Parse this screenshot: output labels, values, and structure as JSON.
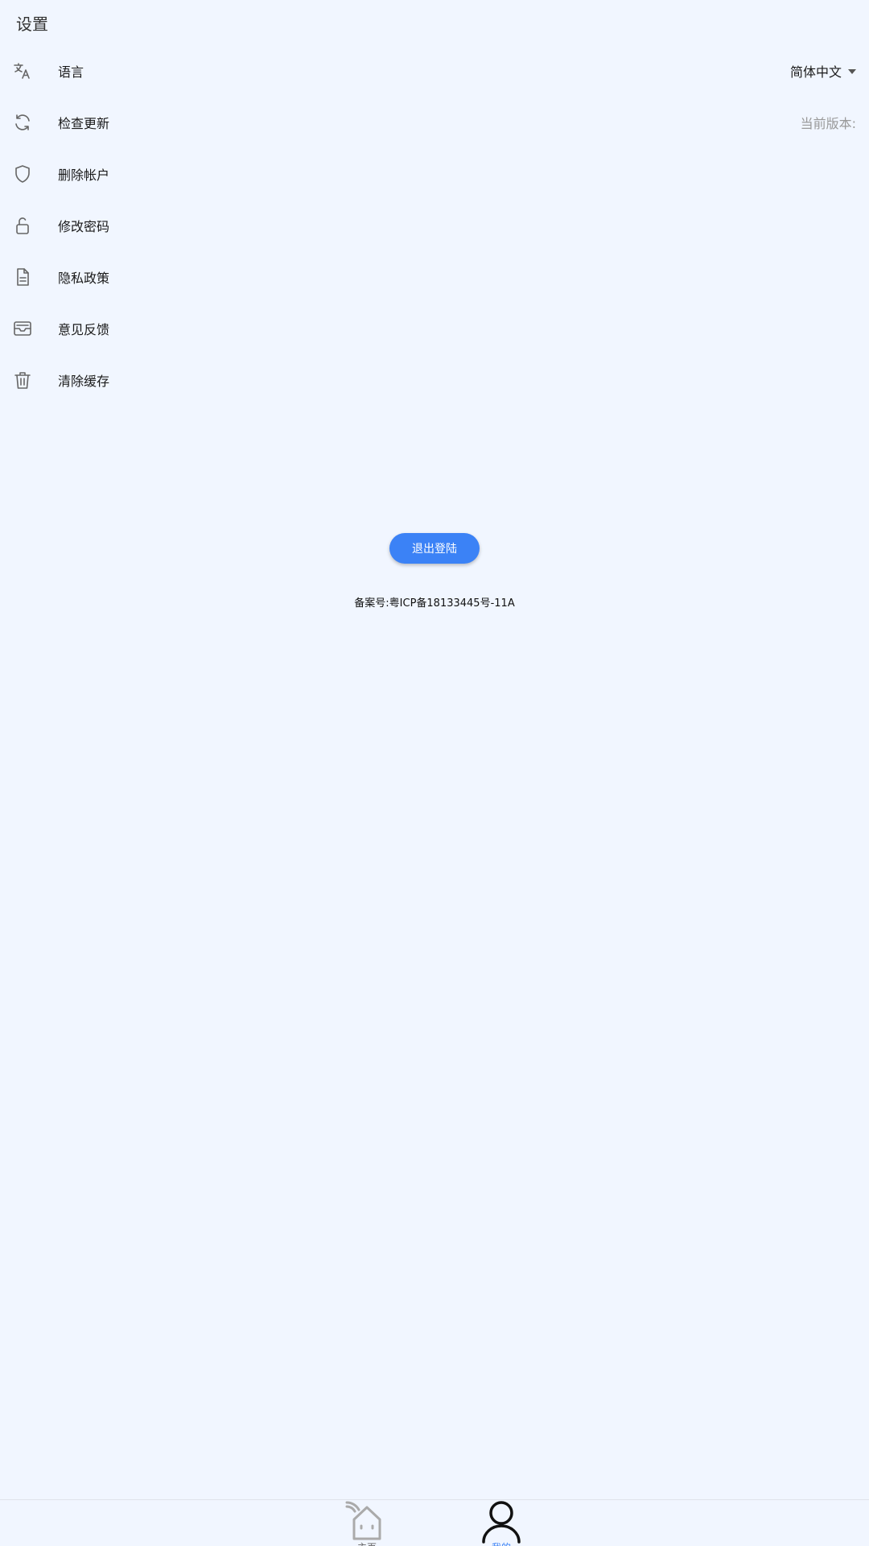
{
  "header": {
    "title": "设置"
  },
  "settings": {
    "items": [
      {
        "icon": "translate-icon",
        "label": "语言"
      },
      {
        "icon": "refresh-icon",
        "label": "检查更新"
      },
      {
        "icon": "shield-icon",
        "label": "删除帐户"
      },
      {
        "icon": "unlock-icon",
        "label": "修改密码"
      },
      {
        "icon": "document-icon",
        "label": "隐私政策"
      },
      {
        "icon": "inbox-icon",
        "label": "意见反馈"
      },
      {
        "icon": "trash-icon",
        "label": "清除缓存"
      }
    ],
    "language_value": "简体中文",
    "version_label": "当前版本:"
  },
  "logout": {
    "label": "退出登陆"
  },
  "footer": {
    "icp": "备案号:粤ICP备18133445号-11A"
  },
  "tabbar": {
    "tabs": [
      {
        "icon": "home-icon",
        "label": "主页",
        "active": false
      },
      {
        "icon": "user-icon",
        "label": "我的",
        "active": true
      }
    ]
  },
  "colors": {
    "background": "#f1f6ff",
    "accent": "#3b82f6",
    "muted": "#999999"
  }
}
